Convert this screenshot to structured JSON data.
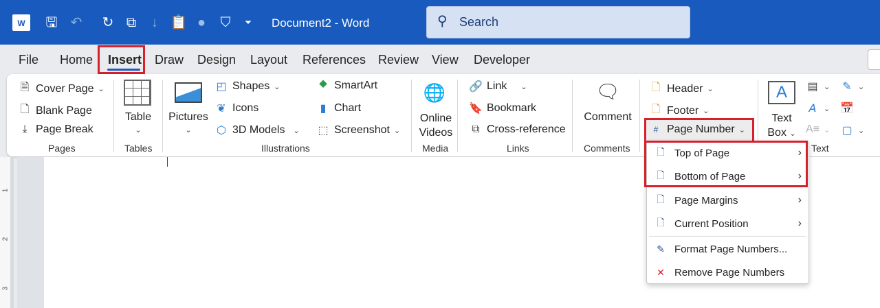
{
  "titlebar": {
    "title": "Document2  -  Word",
    "search_placeholder": "Search"
  },
  "tabs": [
    "File",
    "Home",
    "Insert",
    "Draw",
    "Design",
    "Layout",
    "References",
    "Review",
    "View",
    "Developer"
  ],
  "active_tab": "Insert",
  "ribbon": {
    "pages": {
      "cover_page": "Cover Page",
      "blank_page": "Blank Page",
      "page_break": "Page Break",
      "label": "Pages"
    },
    "tables": {
      "table": "Table",
      "label": "Tables"
    },
    "illustrations": {
      "pictures": "Pictures",
      "shapes": "Shapes",
      "icons": "Icons",
      "models": "3D Models",
      "smartart": "SmartArt",
      "chart": "Chart",
      "screenshot": "Screenshot",
      "label": "Illustrations"
    },
    "media": {
      "online": "Online",
      "videos": "Videos",
      "label": "Media"
    },
    "links": {
      "link": "Link",
      "bookmark": "Bookmark",
      "crossref": "Cross-reference",
      "label": "Links"
    },
    "comments": {
      "comment": "Comment",
      "label": "Comments"
    },
    "header_footer": {
      "header": "Header",
      "footer": "Footer",
      "page_number": "Page Number"
    },
    "text": {
      "text": "Text",
      "box": "Box",
      "label": "Text"
    }
  },
  "ruler": [
    "1",
    "2",
    "3"
  ],
  "page_number_menu": [
    {
      "label": "Top of Page",
      "submenu": true
    },
    {
      "label": "Bottom of Page",
      "submenu": true
    },
    {
      "label": "Page Margins",
      "submenu": true
    },
    {
      "label": "Current Position",
      "submenu": true
    },
    {
      "label": "Format Page Numbers...",
      "submenu": false
    },
    {
      "label": "Remove Page Numbers",
      "submenu": false
    }
  ],
  "colors": {
    "brand": "#185abd",
    "highlight": "#d8202b"
  }
}
